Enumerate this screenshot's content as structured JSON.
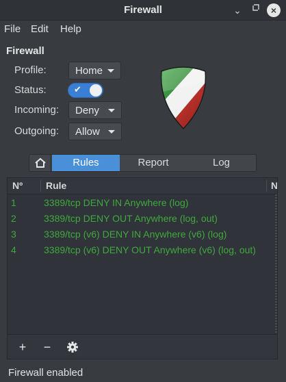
{
  "window": {
    "title": "Firewall",
    "minimize_glyph": "⌄",
    "maximize_glyph": "⌃",
    "close_glyph": "×"
  },
  "menubar": {
    "file": "File",
    "edit": "Edit",
    "help": "Help"
  },
  "panel": {
    "section_title": "Firewall",
    "profile_label": "Profile:",
    "profile_value": "Home",
    "status_label": "Status:",
    "status_enabled": true,
    "incoming_label": "Incoming:",
    "incoming_value": "Deny",
    "outgoing_label": "Outgoing:",
    "outgoing_value": "Allow"
  },
  "tabs": {
    "home_icon": "home-icon",
    "rules": "Rules",
    "report": "Report",
    "log": "Log",
    "active": "Rules"
  },
  "table": {
    "headers": {
      "no": "Nº",
      "rule": "Rule",
      "next": "N"
    },
    "rows": [
      {
        "no": "1",
        "rule": "3389/tcp DENY IN Anywhere (log)"
      },
      {
        "no": "2",
        "rule": "3389/tcp DENY OUT Anywhere (log, out)"
      },
      {
        "no": "3",
        "rule": "3389/tcp (v6) DENY IN Anywhere (v6) (log)"
      },
      {
        "no": "4",
        "rule": "3389/tcp (v6) DENY OUT Anywhere (v6) (log, out)"
      }
    ],
    "row_color": "#40a93c"
  },
  "actions": {
    "add": "+",
    "remove": "−",
    "settings_icon": "gear-icon"
  },
  "statusbar": {
    "text": "Firewall enabled"
  },
  "colors": {
    "accent": "#4a90d9",
    "window_bg": "#383c40"
  }
}
